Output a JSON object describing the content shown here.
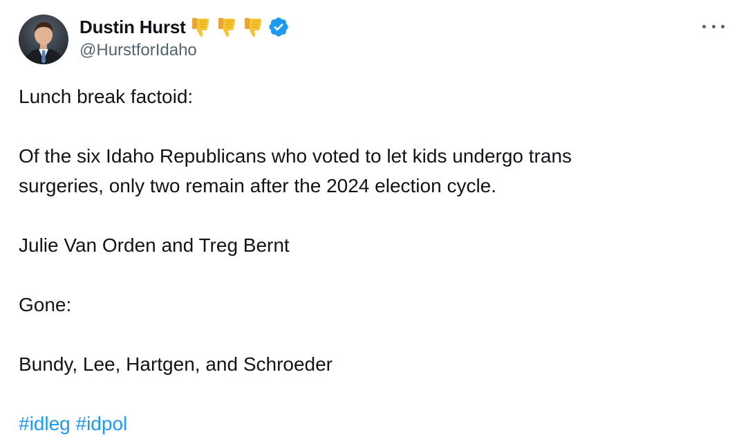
{
  "author": {
    "display_name": "Dustin Hurst",
    "handle": "@HurstforIdaho",
    "verified": true,
    "name_emojis": [
      "thumbs-down-emoji",
      "thumbs-down-emoji",
      "thumbs-down-emoji"
    ],
    "avatar_icon": "profile-photo"
  },
  "menu": {
    "icon": "more-options-icon"
  },
  "tweet": {
    "line1": "Lunch break factoid:",
    "line2": "Of the six Idaho Republicans who voted to let kids undergo trans",
    "line3": "surgeries, only two remain after the 2024 election cycle.",
    "line4": "Julie Van Orden and Treg Bernt",
    "line5": "Gone:",
    "line6": "Bundy, Lee, Hartgen, and Schroeder",
    "hashtags": [
      "#idleg",
      "#idpol"
    ]
  },
  "colors": {
    "text": "#0f1419",
    "secondary": "#536471",
    "link": "#1d9bf0",
    "verified": "#1d9bf0",
    "emoji": "#f7c52f"
  }
}
